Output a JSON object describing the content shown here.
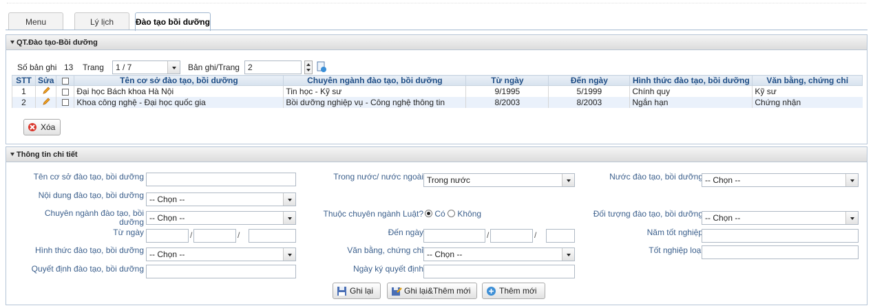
{
  "tabs": [
    "Menu",
    "Lý lịch",
    "Đào tạo bồi dưỡng"
  ],
  "list_panel": {
    "title": "QT.Đào tạo-Bồi dưỡng",
    "record_count_label": "Số bản ghi",
    "record_count": "13",
    "page_label": "Trang",
    "page_value": "1 / 7",
    "per_page_label": "Bản ghi/Trang",
    "per_page_value": "2",
    "columns": [
      "STT",
      "Sửa",
      "",
      "Tên cơ sở đào tạo, bồi dưỡng",
      "Chuyên ngành đào tạo, bồi dưỡng",
      "Từ ngày",
      "Đến ngày",
      "Hình thức đào tạo, bồi dưỡng",
      "Văn bằng, chứng chỉ"
    ],
    "rows": [
      {
        "stt": "1",
        "name": "Đại học Bách khoa Hà Nội",
        "major": "Tin học - Kỹ sư",
        "from": "9/1995",
        "to": "5/1999",
        "form": "Chính quy",
        "cert": "Kỹ sư"
      },
      {
        "stt": "2",
        "name": "Khoa công nghệ - Đại học quốc gia",
        "major": "Bồi dưỡng nghiệp vụ - Công nghệ thông tin",
        "from": "8/2003",
        "to": "8/2003",
        "form": "Ngắn hạn",
        "cert": "Chứng nhận"
      }
    ],
    "delete_label": "Xóa"
  },
  "detail_panel": {
    "title": "Thông tin chi tiết",
    "labels": {
      "school": "Tên cơ sở đào tạo, bồi dưỡng",
      "content": "Nội dung đào tạo, bồi dưỡng",
      "major_l1": "Chuyên ngành đào tạo, bồi",
      "major_l2": "dưỡng",
      "from": "Từ ngày",
      "form": "Hình thức đào tạo, bồi dưỡng",
      "decision": "Quyết định đào tạo, bồi dưỡng",
      "domestic": "Trong nước/ nước ngoài",
      "law": "Thuộc chuyên ngành Luật?",
      "yes": "Có",
      "no": "Không",
      "to": "Đến ngày",
      "cert": "Văn bằng, chứng chỉ",
      "sign_date": "Ngày ký quyết định",
      "country": "Nước đào tạo, bồi dưỡng",
      "target": "Đối tượng đào tạo, bồi dưỡng",
      "grad_year": "Năm tốt nghiệp",
      "grad_rank": "Tốt nghiệp loại"
    },
    "values": {
      "domestic": "Trong nước",
      "choose": "-- Chọn --",
      "date_sep": "/"
    },
    "buttons": {
      "save": "Ghi lại",
      "save_new": "Ghi lại&Thêm mới",
      "new": "Thêm mới"
    }
  }
}
